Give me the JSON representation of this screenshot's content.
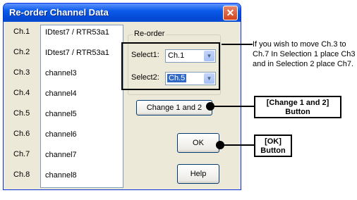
{
  "dialog": {
    "title": "Re-order Channel Data",
    "close_icon": "close-icon",
    "channel_labels": [
      "Ch.1",
      "Ch.2",
      "Ch.3",
      "Ch.4",
      "Ch.5",
      "Ch.6",
      "Ch.7",
      "Ch.8"
    ],
    "channels": [
      "IDtest7 / RTR53a1",
      "IDtest7 / RTR53a1",
      "channel3",
      "channel4",
      "channel5",
      "channel6",
      "channel7",
      "channel8"
    ],
    "reorder": {
      "group_label": "Re-order",
      "select1_label": "Select1:",
      "select1_value": "Ch.1",
      "select2_label": "Select2:",
      "select2_value": "Ch.5",
      "change_button": "Change 1 and 2"
    },
    "ok_button": "OK",
    "help_button": "Help"
  },
  "annotations": {
    "note": "If you wish to move Ch.3 to Ch.7 In Selection 1 place Ch3 and in Selection 2 place Ch7.",
    "change_callout_line1": "[Change 1 and 2]",
    "change_callout_line2": "Button",
    "ok_callout_line1": "[OK]",
    "ok_callout_line2": "Button"
  }
}
